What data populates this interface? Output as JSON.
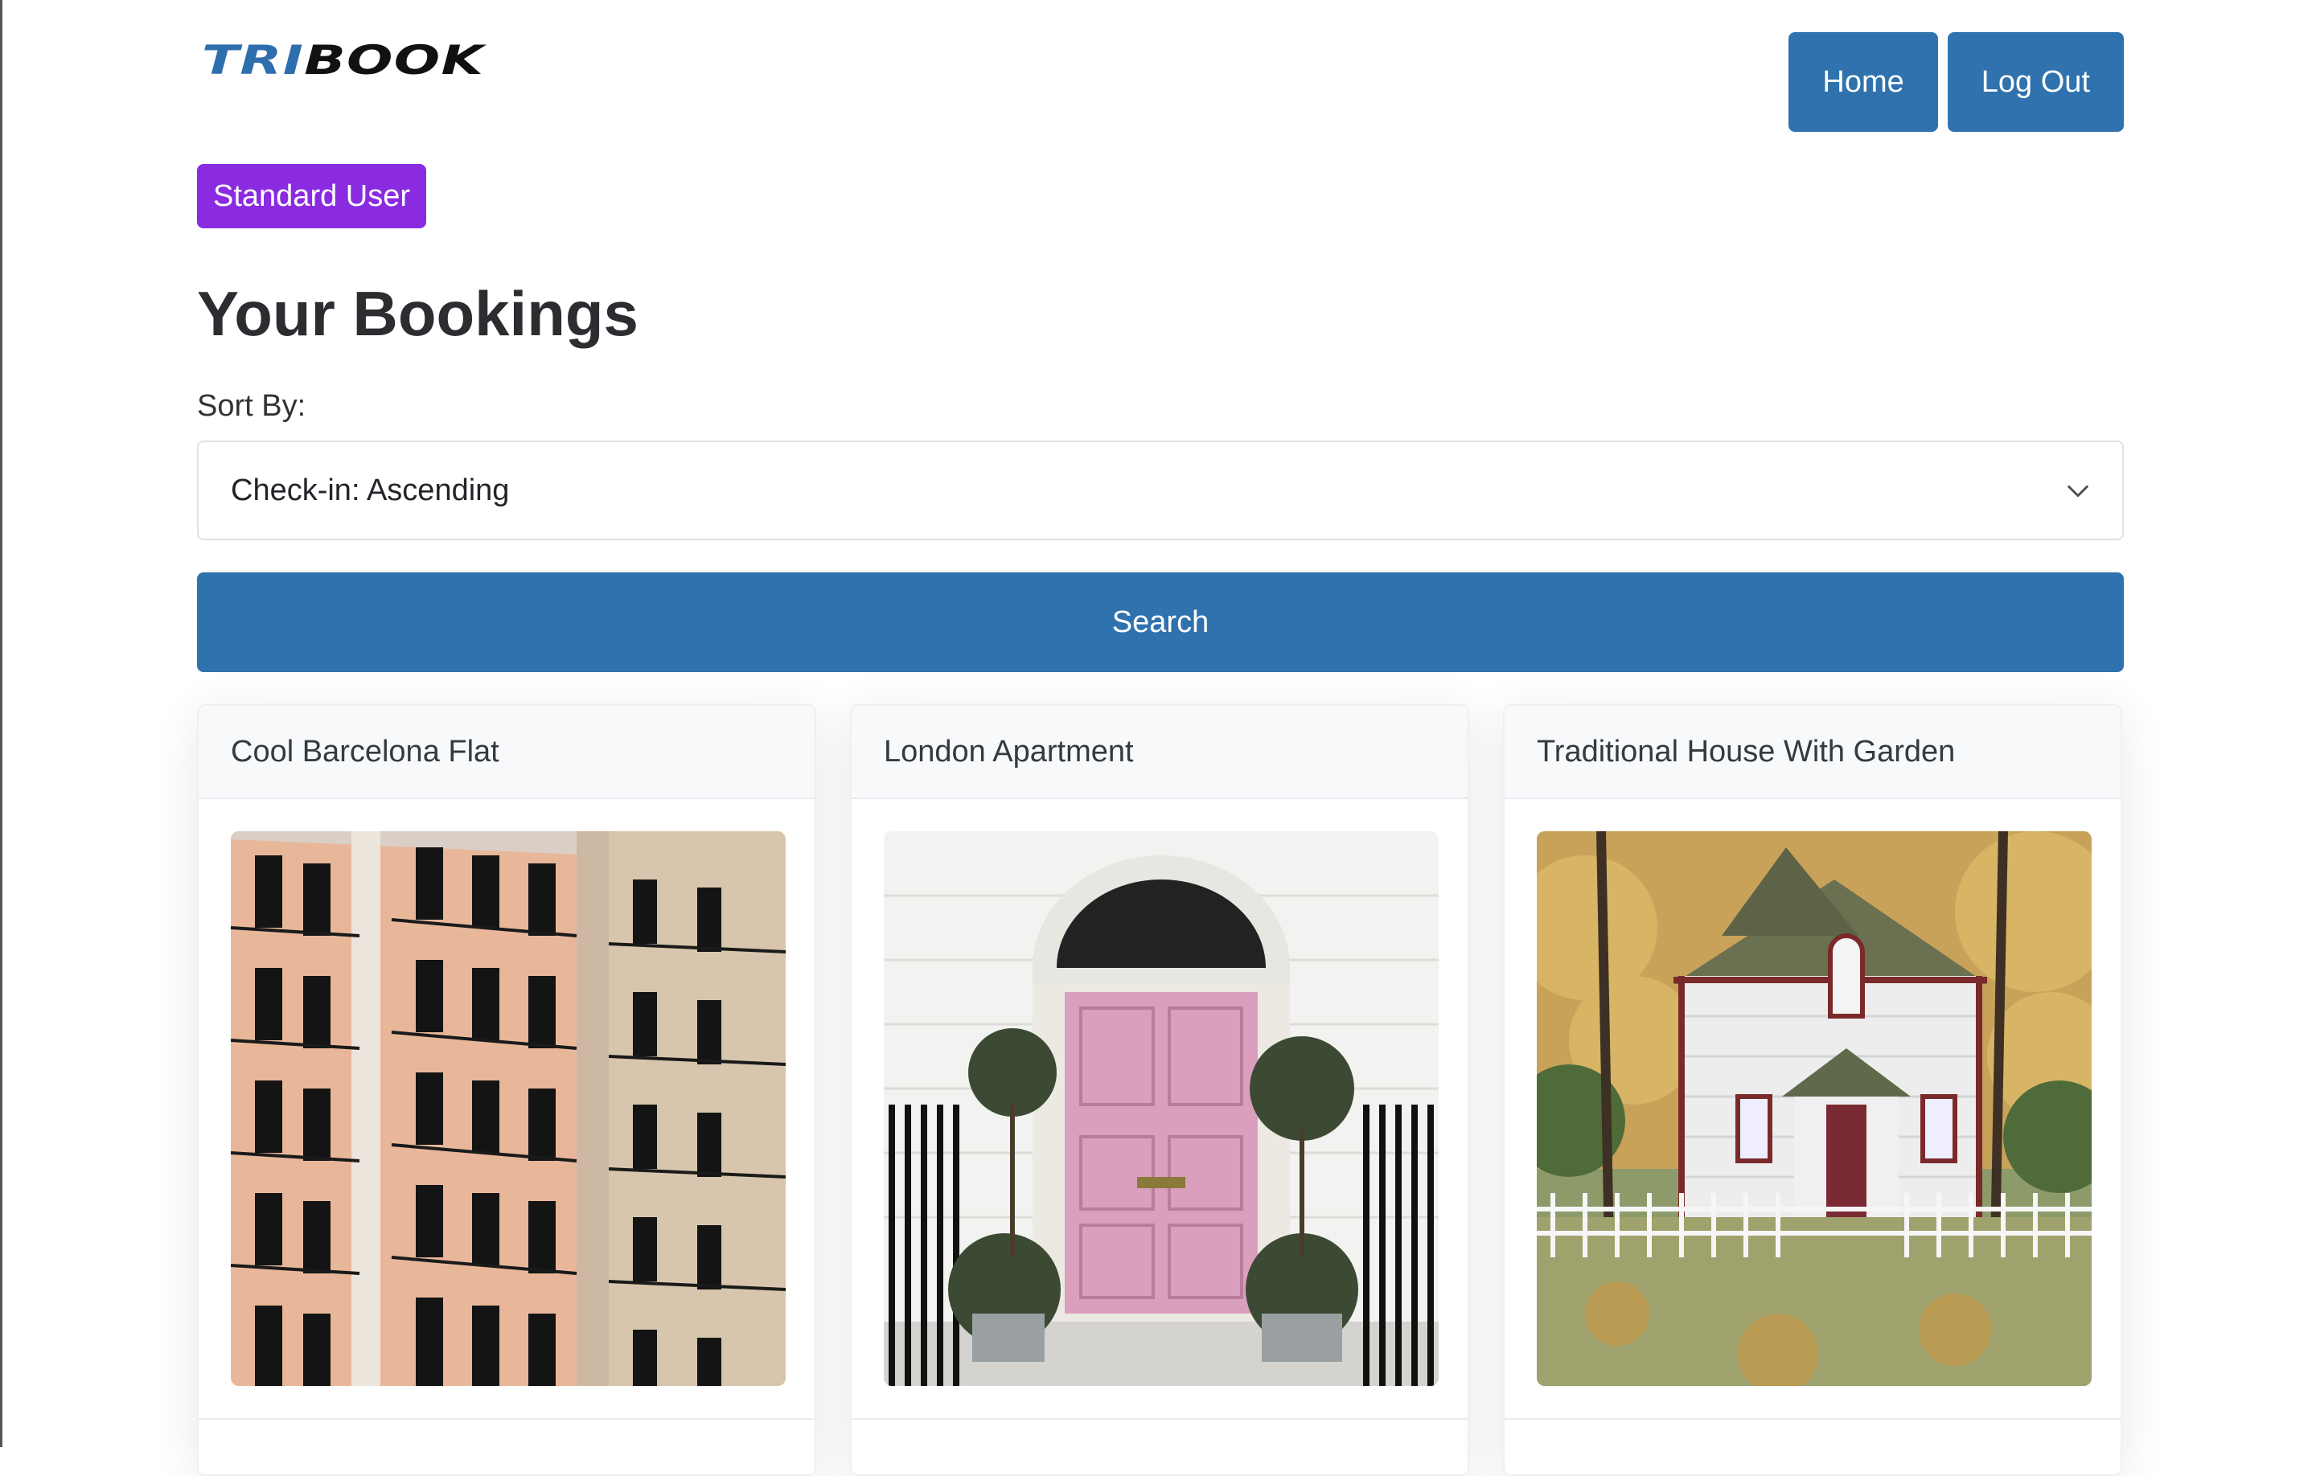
{
  "header": {
    "logo_part1": "TRI",
    "logo_part2": "BOOK",
    "nav": [
      {
        "label": "Home"
      },
      {
        "label": "Log Out"
      }
    ]
  },
  "user_badge": "Standard User",
  "page_title": "Your Bookings",
  "sort": {
    "label": "Sort By:",
    "selected": "Check-in: Ascending"
  },
  "search_label": "Search",
  "bookings": [
    {
      "title": "Cool Barcelona Flat",
      "image": "barcelona-building-photo"
    },
    {
      "title": "London Apartment",
      "image": "pink-door-photo"
    },
    {
      "title": "Traditional House With Garden",
      "image": "white-house-photo"
    }
  ],
  "colors": {
    "primary": "#2f72ad",
    "badge": "#8a2be2",
    "logo_accent": "#2f6ead"
  }
}
